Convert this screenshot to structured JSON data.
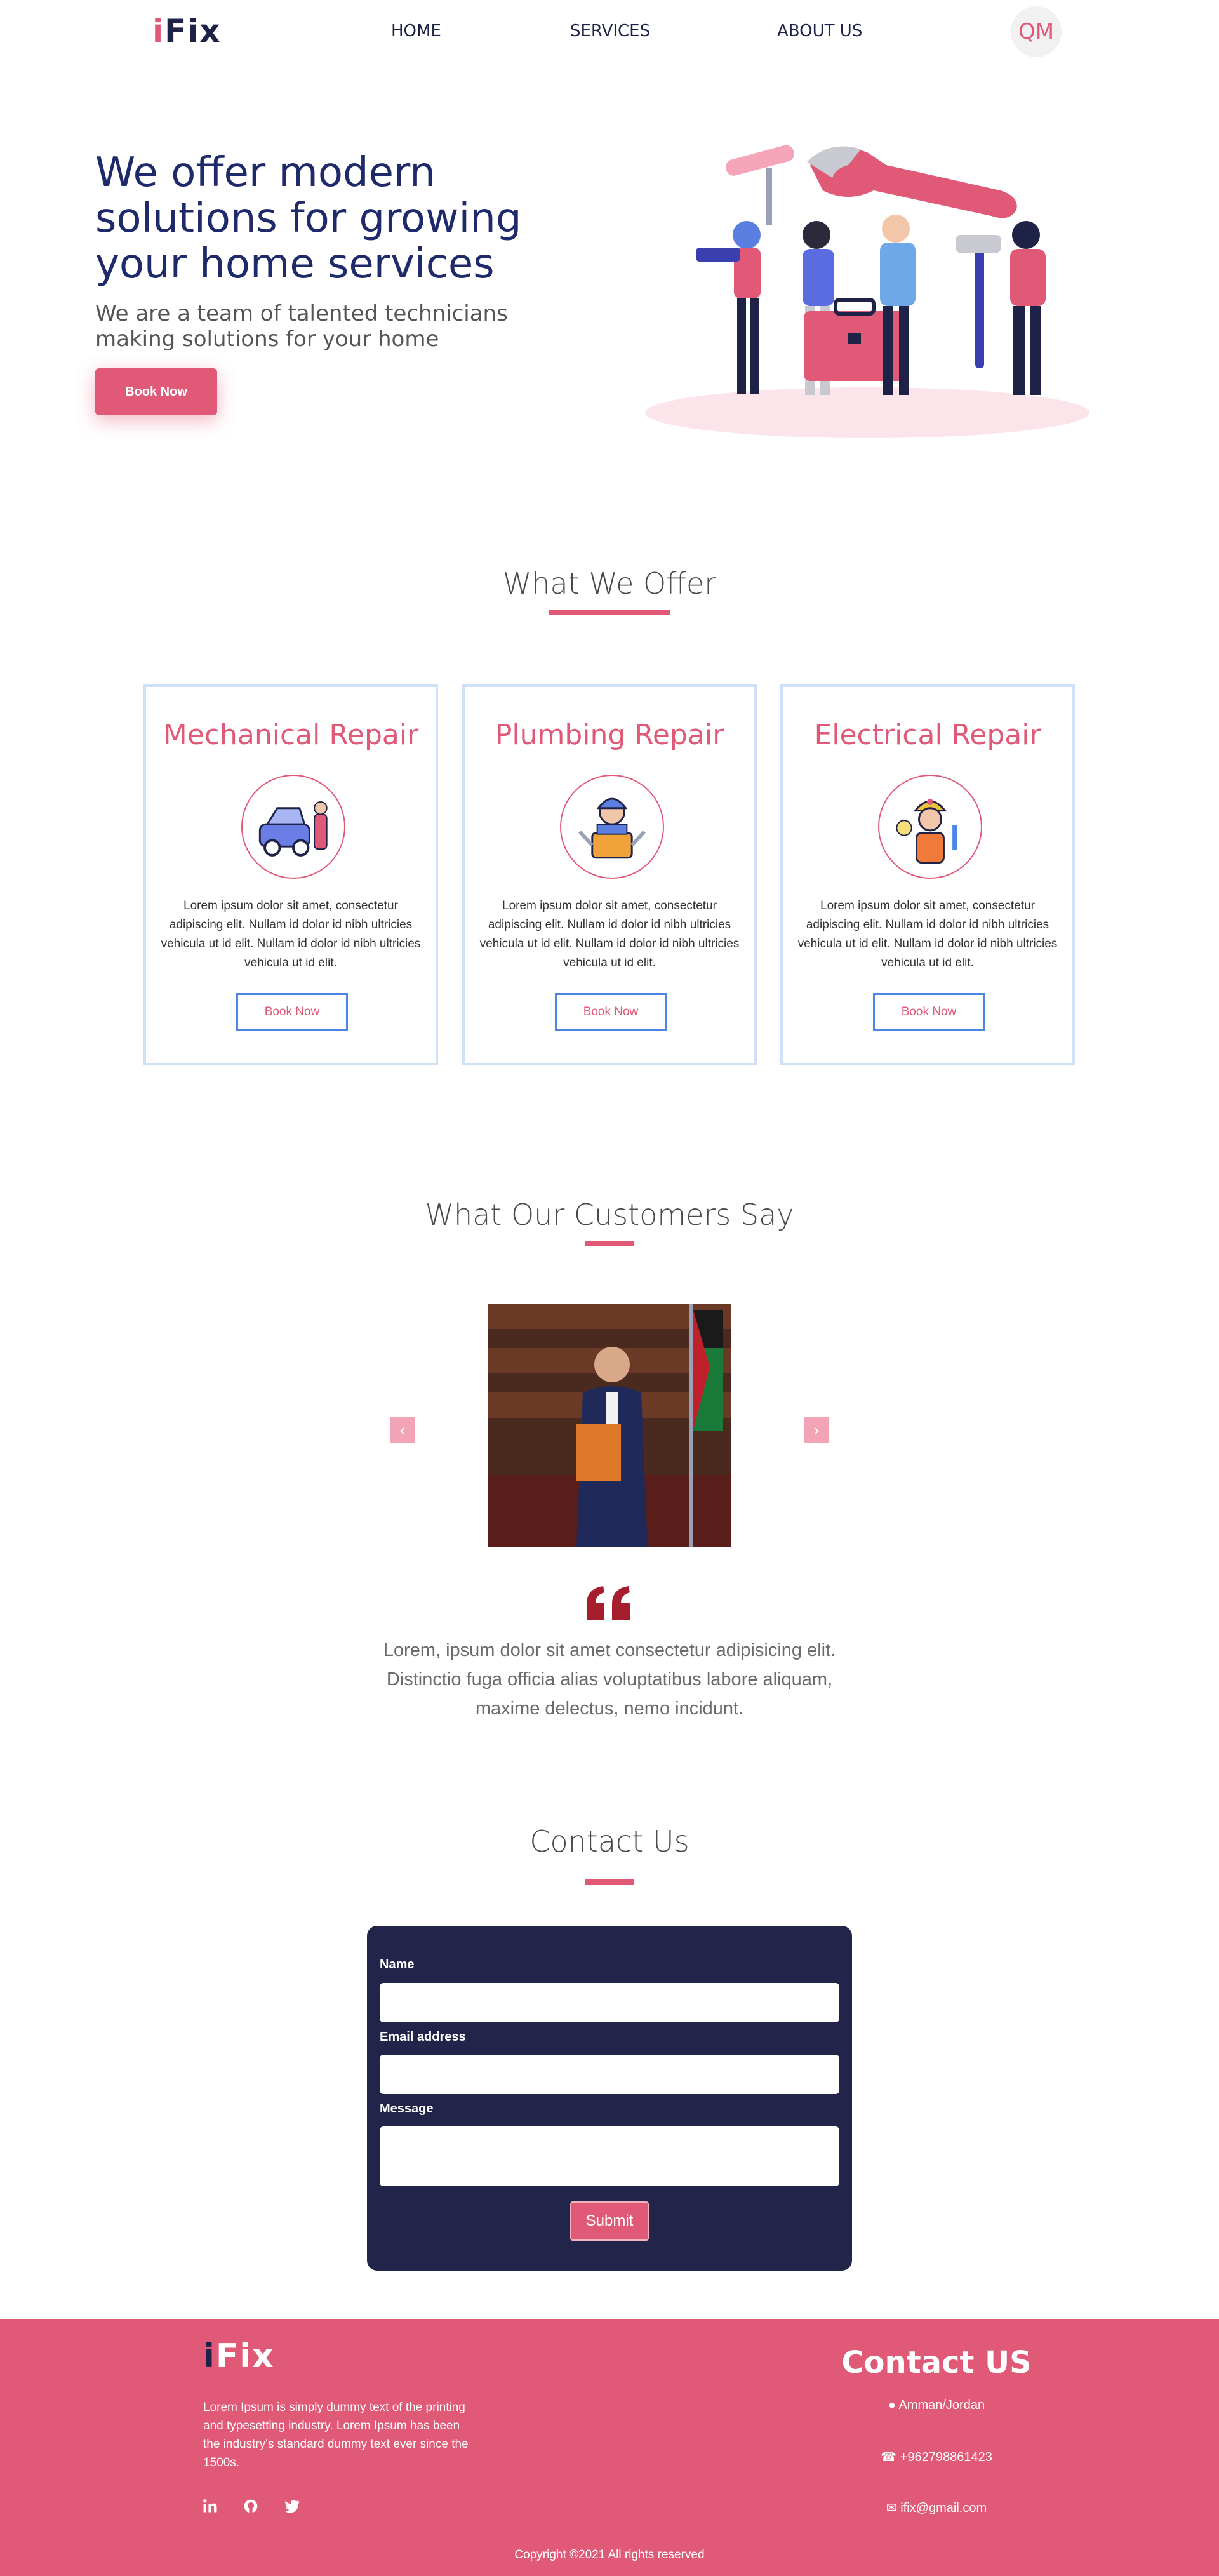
{
  "nav": {
    "logo_accent": "i",
    "logo_rest": "Fix",
    "links": [
      "HOME",
      "SERVICES",
      "ABOUT US"
    ],
    "avatar_initials": "QM"
  },
  "hero": {
    "title": "We offer modern solutions for growing your home services",
    "subtitle": "We are a team of talented technicians making solutions for your home",
    "button": "Book Now"
  },
  "offer": {
    "title": "What We Offer",
    "cards": [
      {
        "title": "Mechanical Repair",
        "icon": "car-mechanic-icon",
        "text": "Lorem ipsum dolor sit amet, consectetur adipiscing elit. Nullam id dolor id nibh ultricies vehicula ut id elit. Nullam id dolor id nibh ultricies vehicula ut id elit.",
        "button": "Book Now"
      },
      {
        "title": "Plumbing Repair",
        "icon": "plumber-icon",
        "text": "Lorem ipsum dolor sit amet, consectetur adipiscing elit. Nullam id dolor id nibh ultricies vehicula ut id elit. Nullam id dolor id nibh ultricies vehicula ut id elit.",
        "button": "Book Now"
      },
      {
        "title": "Electrical Repair",
        "icon": "electrician-icon",
        "text": "Lorem ipsum dolor sit amet, consectetur adipiscing elit. Nullam id dolor id nibh ultricies vehicula ut id elit. Nullam id dolor id nibh ultricies vehicula ut id elit.",
        "button": "Book Now"
      }
    ]
  },
  "testimonials": {
    "title": "What Our Customers Say",
    "prev": "‹",
    "next": "›",
    "quote": "Lorem, ipsum dolor sit amet consectetur adipisicing elit. Distinctio fuga officia alias voluptatibus labore aliquam, maxime delectus, nemo incidunt."
  },
  "contact": {
    "title": "Contact Us",
    "name_label": "Name",
    "email_label": "Email address",
    "message_label": "Message",
    "submit": "Submit"
  },
  "footer": {
    "logo_accent": "i",
    "logo_rest": "Fix",
    "description": "Lorem Ipsum is simply dummy text of the printing and typesetting industry. Lorem Ipsum has been the industry's standard dummy text ever since the 1500s.",
    "contact_title": "Contact US",
    "address": "Amman/Jordan",
    "phone": "+962798861423",
    "email": "ifix@gmail.com",
    "copyright": "Copyright ©2021 All rights reserved",
    "social": [
      "linkedin-icon",
      "github-icon",
      "twitter-icon"
    ]
  },
  "colors": {
    "accent": "#e05a78",
    "navy": "#1f2247",
    "heading_blue": "#1f2a6b",
    "card_border": "#cfe0f8",
    "button_border": "#4a86e8"
  }
}
